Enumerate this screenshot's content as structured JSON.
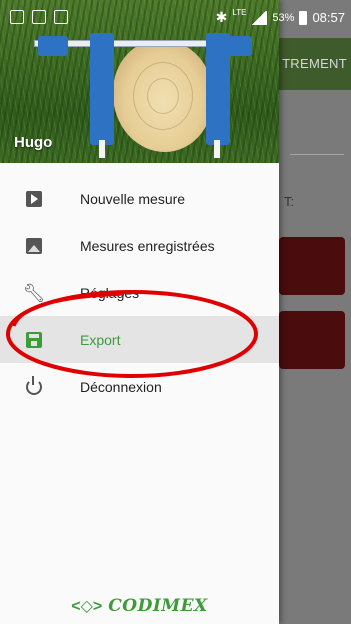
{
  "status_bar": {
    "left_icons": [
      "image-icon",
      "screen-icon",
      "gallery-icon"
    ],
    "network": "LTE",
    "battery": "53%",
    "time": "08:57"
  },
  "background_app": {
    "toolbar_fragment": "TREMENT",
    "label_fragment": "T:"
  },
  "drawer": {
    "user_name": "Hugo",
    "items": [
      {
        "label": "Nouvelle mesure",
        "icon": "play-icon",
        "active": false
      },
      {
        "label": "Mesures enregistrées",
        "icon": "image-icon",
        "active": false
      },
      {
        "label": "Réglages",
        "icon": "wrench-icon",
        "active": false
      },
      {
        "label": "Export",
        "icon": "save-icon",
        "active": true
      },
      {
        "label": "Déconnexion",
        "icon": "power-icon",
        "active": false
      }
    ],
    "logo": "CODIMEX"
  },
  "colors": {
    "accent_green": "#3d9b3a",
    "appbar_green": "#3e5b2b",
    "button_dark_red": "#4a0c0c",
    "annotation_red": "#e00000"
  }
}
